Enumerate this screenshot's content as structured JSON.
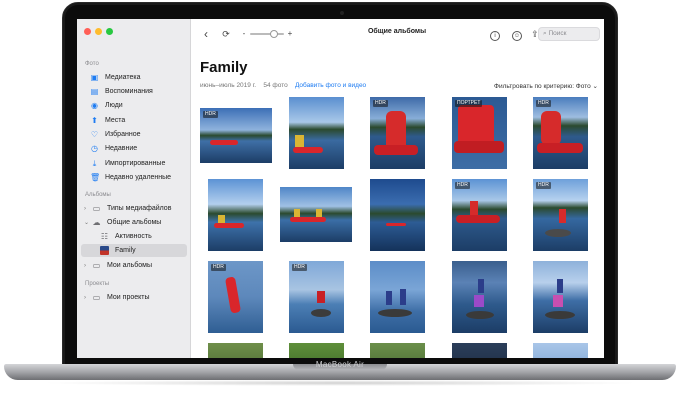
{
  "device": {
    "model_label": "MacBook Air"
  },
  "sidebar": {
    "sections": [
      {
        "title": "Фото"
      },
      {
        "title": "Альбомы"
      },
      {
        "title": "Проекты"
      }
    ],
    "photos_items": [
      {
        "label": "Медиатека",
        "icon": "library-icon"
      },
      {
        "label": "Воспоминания",
        "icon": "memories-icon"
      },
      {
        "label": "Люди",
        "icon": "people-icon"
      },
      {
        "label": "Места",
        "icon": "places-icon"
      },
      {
        "label": "Избранное",
        "icon": "heart-icon"
      },
      {
        "label": "Недавние",
        "icon": "recent-icon"
      },
      {
        "label": "Импортированные",
        "icon": "import-icon"
      },
      {
        "label": "Недавно удаленные",
        "icon": "trash-icon"
      }
    ],
    "album_items": [
      {
        "label": "Типы медиафайлов",
        "icon": "folder-icon"
      },
      {
        "label": "Общие альбомы",
        "icon": "shared-album-icon"
      },
      {
        "label": "Активность",
        "icon": "activity-icon"
      },
      {
        "label": "Family",
        "icon": "album-thumbnail-icon"
      },
      {
        "label": "Мои альбомы",
        "icon": "folder-icon"
      }
    ],
    "project_items": [
      {
        "label": "Мои проекты",
        "icon": "folder-icon"
      }
    ]
  },
  "toolbar": {
    "title": "Общие альбомы",
    "search_placeholder": "Поиск",
    "back_icon": "‹",
    "info_icon": "i",
    "people_icon": "☺",
    "share_icon": "⇪",
    "slider_minus": "-",
    "slider_plus": "+"
  },
  "album": {
    "title": "Family",
    "date_range": "июнь–июль 2019 г.",
    "count": "54 фото",
    "add_link": "Добавить фото и видео",
    "filter_label": "Фильтровать по критерию: Фото",
    "filter_chevron": "⌄"
  },
  "badges": {
    "hdr": "HDR",
    "portrait": "ПОРТРЕТ"
  },
  "colors": {
    "accent": "#1e7cf2",
    "sidebar_bg": "#ececee",
    "kayak_red": "#d9262b"
  }
}
